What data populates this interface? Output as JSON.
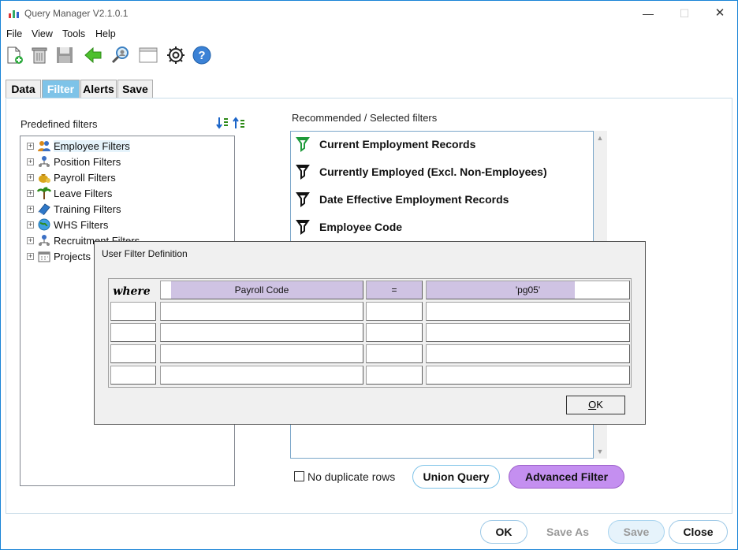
{
  "window": {
    "title": "Query Manager V2.1.0.1"
  },
  "window_controls": {
    "minimize": "—",
    "maximize": "☐",
    "close": "✕"
  },
  "menu": {
    "items": [
      "File",
      "View",
      "Tools",
      "Help"
    ]
  },
  "toolbar": {
    "buttons": [
      "new-document-icon",
      "delete-icon",
      "save-icon",
      "back-arrow-icon",
      "search-person-icon",
      "window-icon",
      "settings-icon",
      "help-icon"
    ]
  },
  "tabs": [
    {
      "label": "Data",
      "active": false
    },
    {
      "label": "Filter",
      "active": true
    },
    {
      "label": "Alerts",
      "active": false
    },
    {
      "label": "Save",
      "active": false
    }
  ],
  "predefined": {
    "label": "Predefined filters",
    "items": [
      {
        "label": "Employee Filters",
        "icon": "people-icon"
      },
      {
        "label": "Position Filters",
        "icon": "org-chart-icon"
      },
      {
        "label": "Payroll Filters",
        "icon": "money-bag-icon"
      },
      {
        "label": "Leave Filters",
        "icon": "palm-tree-icon"
      },
      {
        "label": "Training Filters",
        "icon": "book-icon"
      },
      {
        "label": "WHS Filters",
        "icon": "globe-icon"
      },
      {
        "label": "Recruitment Filters",
        "icon": "org-chart-icon"
      },
      {
        "label": "Projects",
        "icon": "calendar-icon"
      }
    ]
  },
  "recommended": {
    "label": "Recommended / Selected filters",
    "items": [
      {
        "label": "Current Employment Records",
        "selected": true
      },
      {
        "label": "Currently Employed (Excl. Non-Employees)",
        "selected": false
      },
      {
        "label": "Date Effective Employment Records",
        "selected": false
      },
      {
        "label": "Employee Code",
        "selected": false
      }
    ]
  },
  "options": {
    "no_duplicate_rows": "No duplicate rows",
    "no_duplicate_checked": false
  },
  "buttons": {
    "union_query": "Union Query",
    "advanced_filter": "Advanced Filter",
    "ok": "OK",
    "save_as": "Save As",
    "save": "Save",
    "close": "Close"
  },
  "dialog": {
    "title": "User Filter Definition",
    "where_label": "where",
    "rows": [
      {
        "field": "Payroll Code",
        "operator": "=",
        "value": "'pg05'"
      },
      {
        "field": "",
        "operator": "",
        "value": ""
      },
      {
        "field": "",
        "operator": "",
        "value": ""
      },
      {
        "field": "",
        "operator": "",
        "value": ""
      },
      {
        "field": "",
        "operator": "",
        "value": ""
      }
    ],
    "ok_label": "OK",
    "ok_mnemonic": "O",
    "ok_rest": "K"
  },
  "colors": {
    "active_tab": "#7ec3e8",
    "advanced_filter": "#c48ff0",
    "selection_highlight": "#cfc3e3",
    "window_border": "#1883d7"
  }
}
